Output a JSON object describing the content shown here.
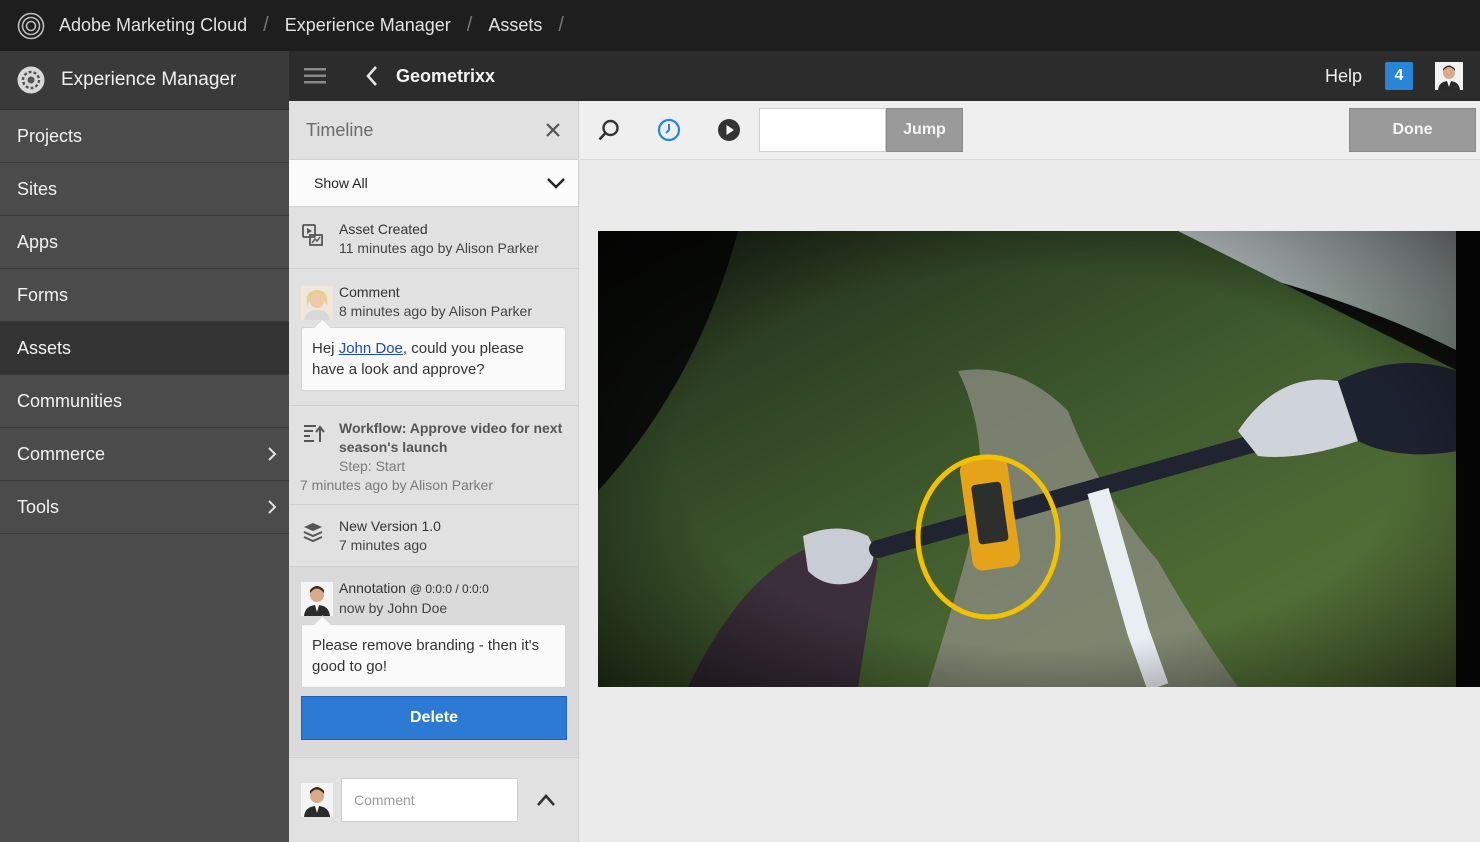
{
  "global_bar": {
    "breadcrumbs": [
      "Adobe Marketing Cloud",
      "Experience Manager",
      "Assets"
    ],
    "separator": "/"
  },
  "sidebar": {
    "title": "Experience Manager",
    "items": [
      {
        "label": "Projects"
      },
      {
        "label": "Sites"
      },
      {
        "label": "Apps"
      },
      {
        "label": "Forms"
      },
      {
        "label": "Assets",
        "active": true
      },
      {
        "label": "Communities"
      },
      {
        "label": "Commerce",
        "has_children": true
      },
      {
        "label": "Tools",
        "has_children": true
      }
    ]
  },
  "header": {
    "title": "Geometrixx",
    "help_label": "Help",
    "notification_count": "4"
  },
  "timeline": {
    "title": "Timeline",
    "filter_value": "Show All",
    "events": [
      {
        "title": "Asset Created",
        "meta": "11 minutes ago by Alison Parker",
        "icon": "asset-created-icon"
      },
      {
        "title": "Comment",
        "meta": "8 minutes ago by Alison Parker",
        "comment_prefix": "Hej ",
        "comment_mention": "John Doe",
        "comment_suffix": ", could you please have a look and approve?"
      },
      {
        "title": "Workflow: Approve video for next season's launch",
        "step": "Step: Start",
        "meta": "7 minutes ago by Alison Parker",
        "icon": "workflow-icon"
      },
      {
        "title": "New Version 1.0",
        "meta": "7 minutes ago",
        "icon": "layers-icon"
      },
      {
        "title": "Annotation",
        "time": "@ 0:0:0 / 0:0:0",
        "meta": "now by John Doe",
        "comment": "Please remove branding - then it's good to go!"
      }
    ],
    "delete_label": "Delete",
    "comment_placeholder": "Comment"
  },
  "toolbar": {
    "jump_value": "",
    "jump_label": "Jump",
    "done_label": "Done"
  },
  "colors": {
    "accent": "#2c7ad3",
    "badge": "#2b85d6",
    "annotation_ring": "#f2c200"
  }
}
